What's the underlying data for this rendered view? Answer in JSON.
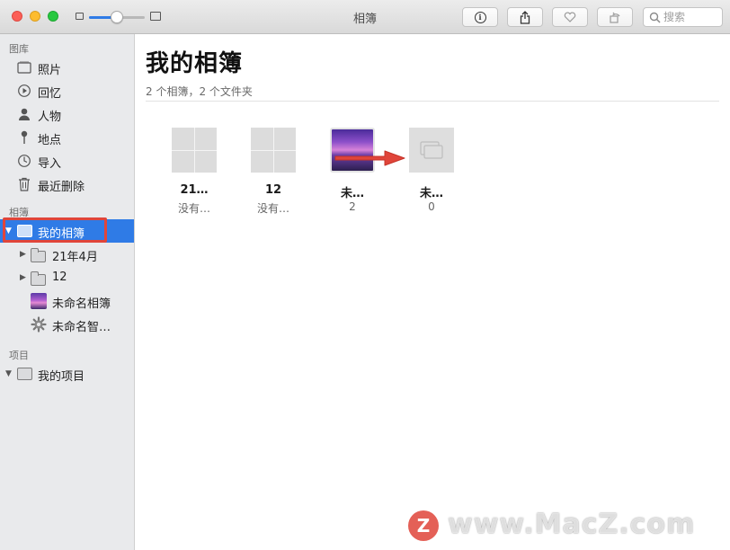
{
  "window": {
    "title": "相簿"
  },
  "toolbar": {
    "search_placeholder": "搜索",
    "icons": [
      "info-icon",
      "share-icon",
      "heart-icon",
      "rotate-icon",
      "search-icon"
    ]
  },
  "sidebar": {
    "library_header": "图库",
    "library_items": [
      {
        "label": "照片",
        "icon": "photos-icon"
      },
      {
        "label": "回忆",
        "icon": "memories-icon"
      },
      {
        "label": "人物",
        "icon": "people-icon"
      },
      {
        "label": "地点",
        "icon": "places-icon"
      },
      {
        "label": "导入",
        "icon": "imports-icon"
      },
      {
        "label": "最近删除",
        "icon": "trash-icon"
      }
    ],
    "albums_header": "相簿",
    "albums_items": [
      {
        "label": "我的相簿",
        "icon": "album-icon",
        "selected": true
      },
      {
        "label": "21年4月",
        "icon": "folder-icon"
      },
      {
        "label": "12",
        "icon": "folder-icon"
      },
      {
        "label": "未命名相簿",
        "icon": "photo-thumbnail"
      },
      {
        "label": "未命名智…",
        "icon": "gear-icon"
      }
    ],
    "projects_header": "项目",
    "projects_items": [
      {
        "label": "我的项目",
        "icon": "album-icon"
      }
    ]
  },
  "main": {
    "title": "我的相簿",
    "subtitle": "2 个相簿，2 个文件夹",
    "albums": [
      {
        "name": "21…",
        "count": "没有…"
      },
      {
        "name": "12",
        "count": "没有…"
      },
      {
        "name": "未…",
        "count": "2"
      },
      {
        "name": "未…",
        "count": "0"
      }
    ]
  },
  "watermark": {
    "text": "www.MacZ.com",
    "logo": "Z"
  },
  "colors": {
    "selection": "#2f7be6",
    "annotation": "#e0453a"
  }
}
